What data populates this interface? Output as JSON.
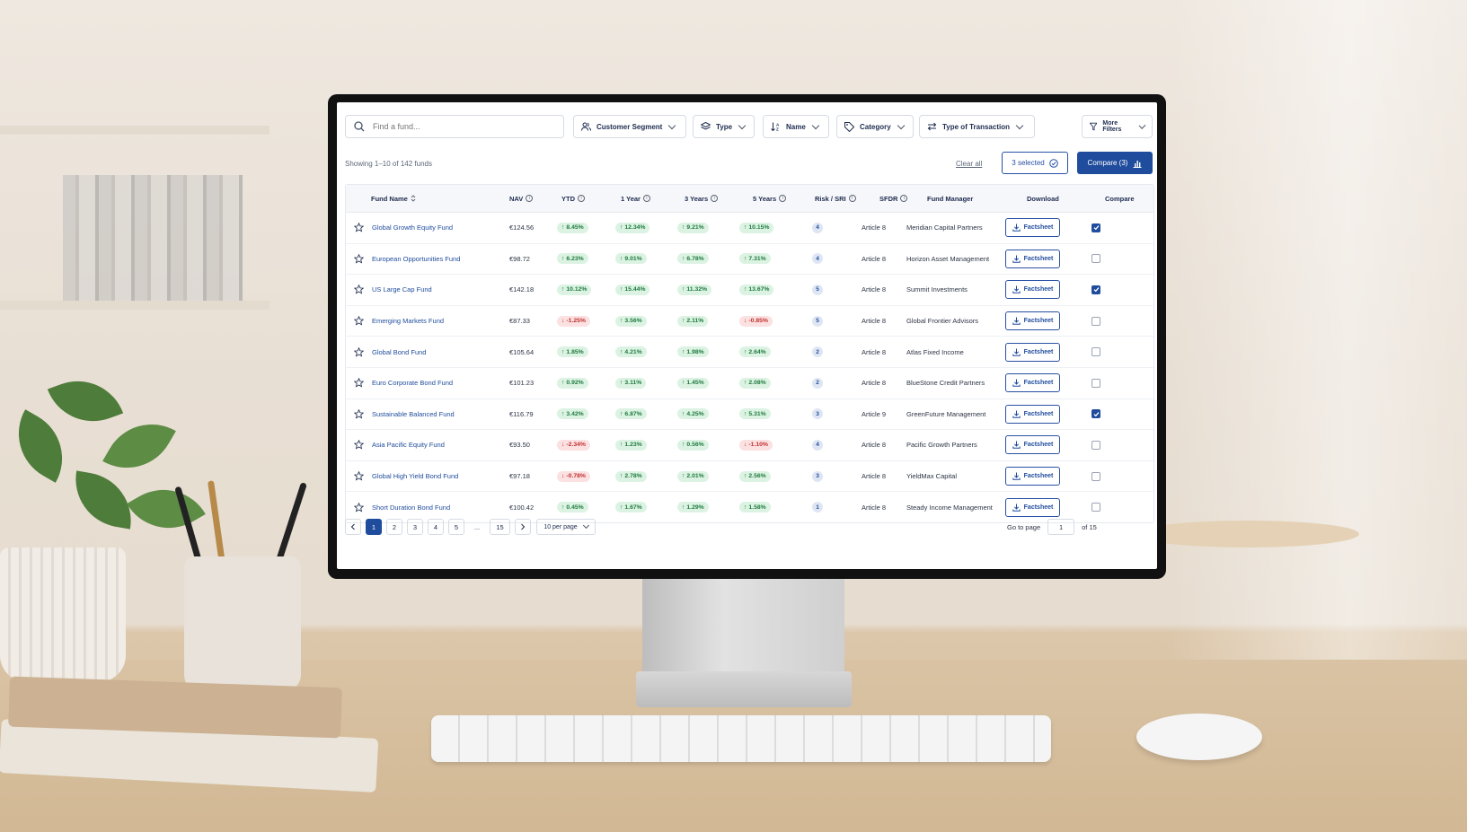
{
  "search": {
    "placeholder": "Find a fund..."
  },
  "filters": [
    {
      "label": "Customer Segment",
      "icon": "users-icon"
    },
    {
      "label": "Type",
      "icon": "layers-icon"
    },
    {
      "label": "Name",
      "icon": "sort-alpha-icon"
    },
    {
      "label": "Category",
      "icon": "tag-icon"
    },
    {
      "label": "Type of Transaction",
      "icon": "swap-icon"
    },
    {
      "label": "More Filters",
      "icon": "filter-icon"
    }
  ],
  "summary": {
    "showing": "Showing 1–10 of 142 funds",
    "clear_all": "Clear all",
    "selected": "3 selected",
    "compare": "Compare (3)"
  },
  "columns": {
    "fund_name": "Fund Name",
    "nav": "NAV",
    "ytd": "YTD",
    "one_year": "1 Year",
    "three_years": "3 Years",
    "five_years": "5 Years",
    "risk": "Risk / SRI",
    "sfdr": "SFDR",
    "manager": "Fund Manager",
    "download": "Download",
    "compare": "Compare"
  },
  "download_label": "Factsheet",
  "rows": [
    {
      "name": "Global Growth Equity Fund",
      "nav": "€124.56",
      "ytd": "8.45%",
      "y1": "12.34%",
      "y3": "9.21%",
      "y5": "10.15%",
      "risk": "4",
      "sfdr": "Article 8",
      "manager": "Meridian Capital Partners",
      "compare": true
    },
    {
      "name": "European Opportunities Fund",
      "nav": "€98.72",
      "ytd": "6.23%",
      "y1": "9.01%",
      "y3": "6.78%",
      "y5": "7.31%",
      "risk": "4",
      "sfdr": "Article 8",
      "manager": "Horizon Asset Management",
      "compare": false
    },
    {
      "name": "US Large Cap Fund",
      "nav": "€142.18",
      "ytd": "10.12%",
      "y1": "15.44%",
      "y3": "11.32%",
      "y5": "13.67%",
      "risk": "5",
      "sfdr": "Article 8",
      "manager": "Summit Investments",
      "compare": true
    },
    {
      "name": "Emerging Markets Fund",
      "nav": "€87.33",
      "ytd": "-1.25%",
      "y1": "3.56%",
      "y3": "2.11%",
      "y5": "-0.85%",
      "risk": "5",
      "sfdr": "Article 8",
      "manager": "Global Frontier Advisors",
      "compare": false
    },
    {
      "name": "Global Bond Fund",
      "nav": "€105.64",
      "ytd": "1.85%",
      "y1": "4.21%",
      "y3": "1.98%",
      "y5": "2.64%",
      "risk": "2",
      "sfdr": "Article 8",
      "manager": "Atlas Fixed Income",
      "compare": false
    },
    {
      "name": "Euro Corporate Bond Fund",
      "nav": "€101.23",
      "ytd": "0.92%",
      "y1": "3.11%",
      "y3": "1.45%",
      "y5": "2.08%",
      "risk": "2",
      "sfdr": "Article 8",
      "manager": "BlueStone Credit Partners",
      "compare": false
    },
    {
      "name": "Sustainable Balanced Fund",
      "nav": "€116.79",
      "ytd": "3.42%",
      "y1": "6.87%",
      "y3": "4.25%",
      "y5": "5.31%",
      "risk": "3",
      "sfdr": "Article 9",
      "manager": "GreenFuture Management",
      "compare": true
    },
    {
      "name": "Asia Pacific Equity Fund",
      "nav": "€93.50",
      "ytd": "-2.34%",
      "y1": "1.23%",
      "y3": "0.56%",
      "y5": "-1.10%",
      "risk": "4",
      "sfdr": "Article 8",
      "manager": "Pacific Growth Partners",
      "compare": false
    },
    {
      "name": "Global High Yield Bond Fund",
      "nav": "€97.18",
      "ytd": "-0.78%",
      "y1": "2.78%",
      "y3": "2.01%",
      "y5": "2.56%",
      "risk": "3",
      "sfdr": "Article 8",
      "manager": "YieldMax Capital",
      "compare": false
    },
    {
      "name": "Short Duration Bond Fund",
      "nav": "€100.42",
      "ytd": "0.45%",
      "y1": "1.67%",
      "y3": "1.29%",
      "y5": "1.58%",
      "risk": "1",
      "sfdr": "Article 8",
      "manager": "Steady Income Management",
      "compare": false
    }
  ],
  "pagination": {
    "pages": [
      "1",
      "2",
      "3",
      "4",
      "5",
      "...",
      "15"
    ],
    "current": "1",
    "per_page": "10 per page",
    "go_to_label": "Go to page",
    "go_to_value": "1",
    "of_label": "of 15"
  },
  "colors": {
    "primary": "#1f4c9d",
    "positive": "#1f7a3e",
    "negative": "#c23030"
  }
}
